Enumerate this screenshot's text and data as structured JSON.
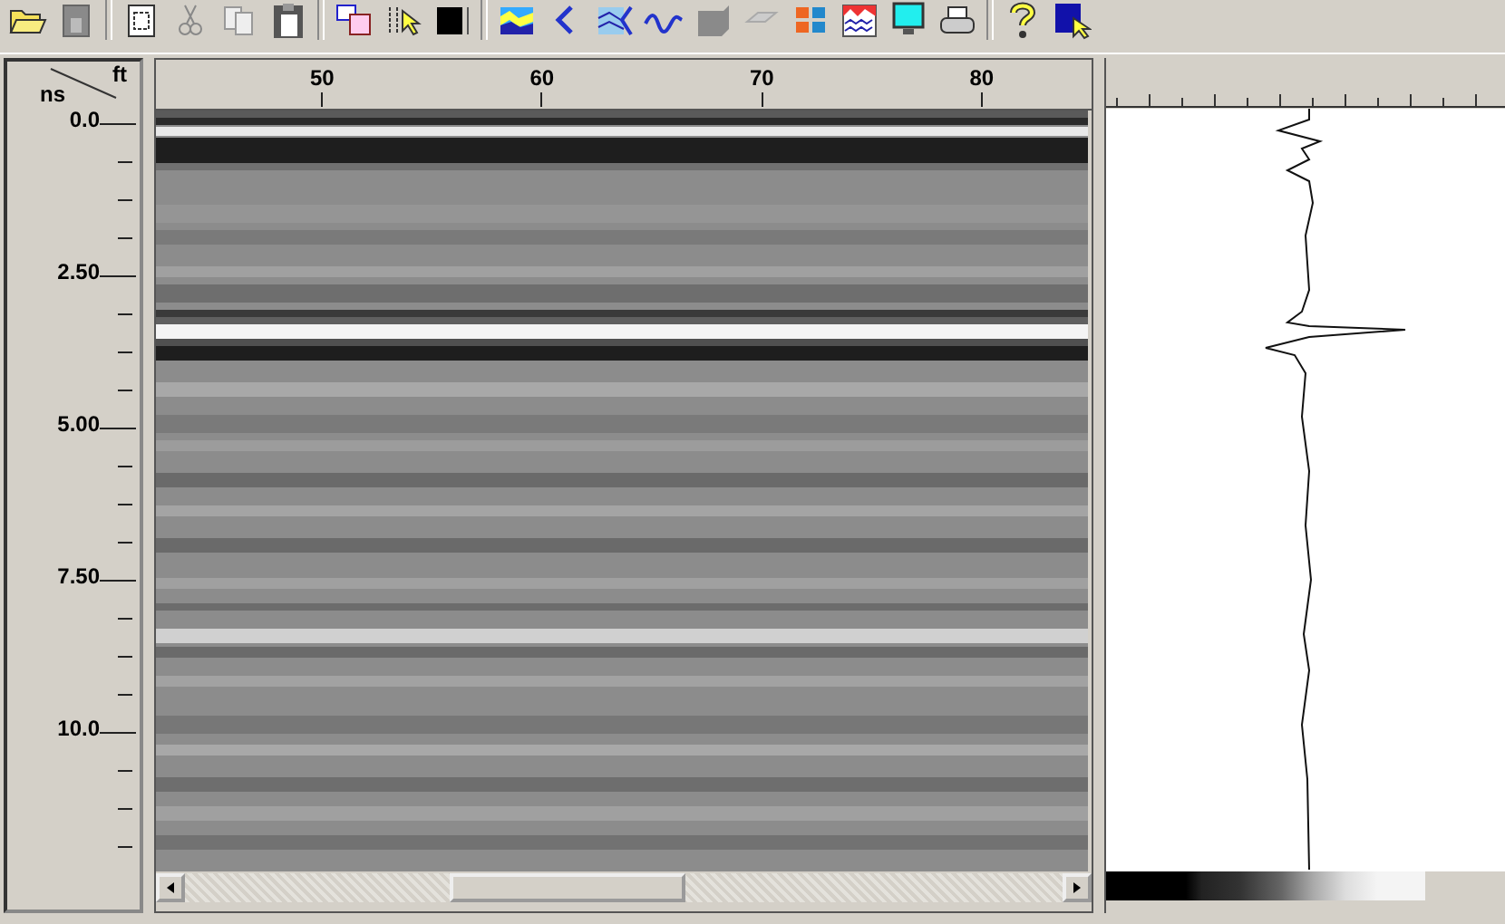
{
  "distance_axis": {
    "unit": "ft",
    "labels": [
      "50",
      "60",
      "70",
      "80"
    ]
  },
  "time_axis": {
    "unit": "ns",
    "labels": [
      "0.0",
      "2.50",
      "5.00",
      "7.50",
      "10.0"
    ]
  }
}
